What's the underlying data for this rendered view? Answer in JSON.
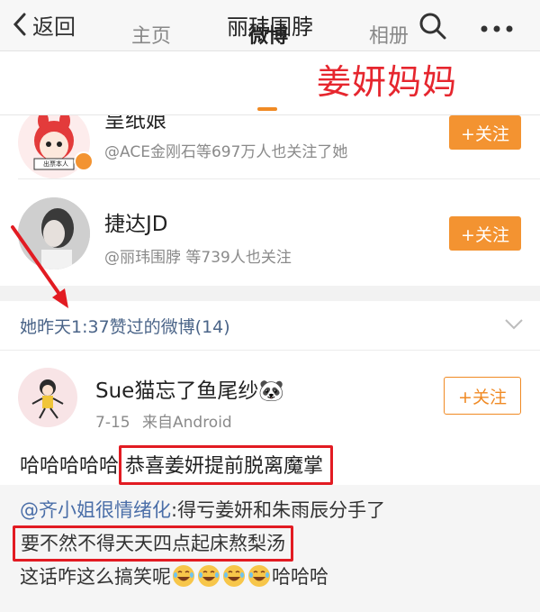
{
  "nav": {
    "back_label": "返回",
    "title": "丽玮围脖"
  },
  "tabs": [
    {
      "label": "主页"
    },
    {
      "label": "微博"
    },
    {
      "label": "相册"
    }
  ],
  "overlay_caption": "姜妍妈妈",
  "users": [
    {
      "name": "呈纸娘",
      "subtitle": "@ACE金刚石等697万人也关注了她",
      "follow_label": "+关注",
      "avatar_tag": "出票本人"
    },
    {
      "name": "捷达JD",
      "subtitle": "@丽玮围脖 等739人也关注",
      "follow_label": "+关注"
    }
  ],
  "liked_header": "她昨天1:37赞过的微博(14)",
  "post": {
    "author": "Sue猫忘了鱼尾纱🐼",
    "meta_date": "7-15",
    "meta_source": "来自Android",
    "follow_label": "+关注",
    "text_prefix": "哈哈哈哈哈",
    "text_boxed": "恭喜姜妍提前脱离魔掌"
  },
  "repost": {
    "mention": "@齐小姐很情绪化",
    "line1_rest": ":得亏姜妍和朱雨辰分手了",
    "line2_boxed": "要不然不得天天四点起床熬梨汤",
    "line3_text": "这话咋这么搞笑呢",
    "line3_suffix": "哈哈哈",
    "emoji_names": [
      "laugh-cry-emoji",
      "laugh-cry-emoji",
      "laugh-cry-emoji",
      "laugh-cry-emoji"
    ]
  },
  "colors": {
    "accent": "#f08a24",
    "overlay_red": "#e6262e",
    "link_blue": "#4a6488",
    "box_red": "#e21b22"
  }
}
